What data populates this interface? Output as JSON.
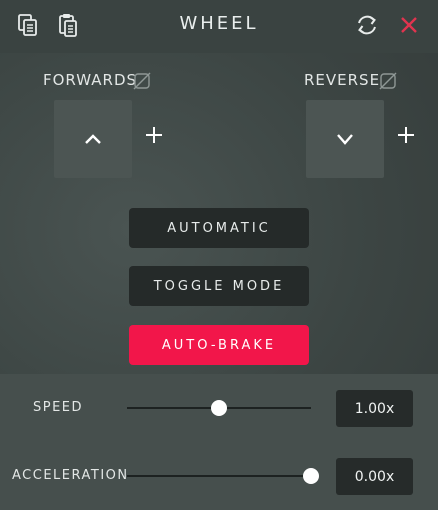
{
  "window": {
    "title": "WHEEL"
  },
  "header": {
    "copy_icon": "copy-icon",
    "paste_icon": "paste-icon",
    "reset_icon": "refresh-icon",
    "close_icon": "close-icon",
    "close_color": "#e0344f"
  },
  "forwards": {
    "label": "FORWARDS",
    "key": "^",
    "add": "+"
  },
  "reverse": {
    "label": "REVERSE",
    "key": "v",
    "add": "+"
  },
  "modes": {
    "automatic": "AUTOMATIC",
    "toggle": "TOGGLE MODE",
    "autobrake": "AUTO-BRAKE",
    "autobrake_color": "#f2164a"
  },
  "sliders": {
    "speed": {
      "label": "SPEED",
      "value_text": "1.00x",
      "fraction": 0.5
    },
    "acceleration": {
      "label": "ACCELERATION",
      "value_text": "0.00x",
      "fraction": 1.0
    }
  }
}
